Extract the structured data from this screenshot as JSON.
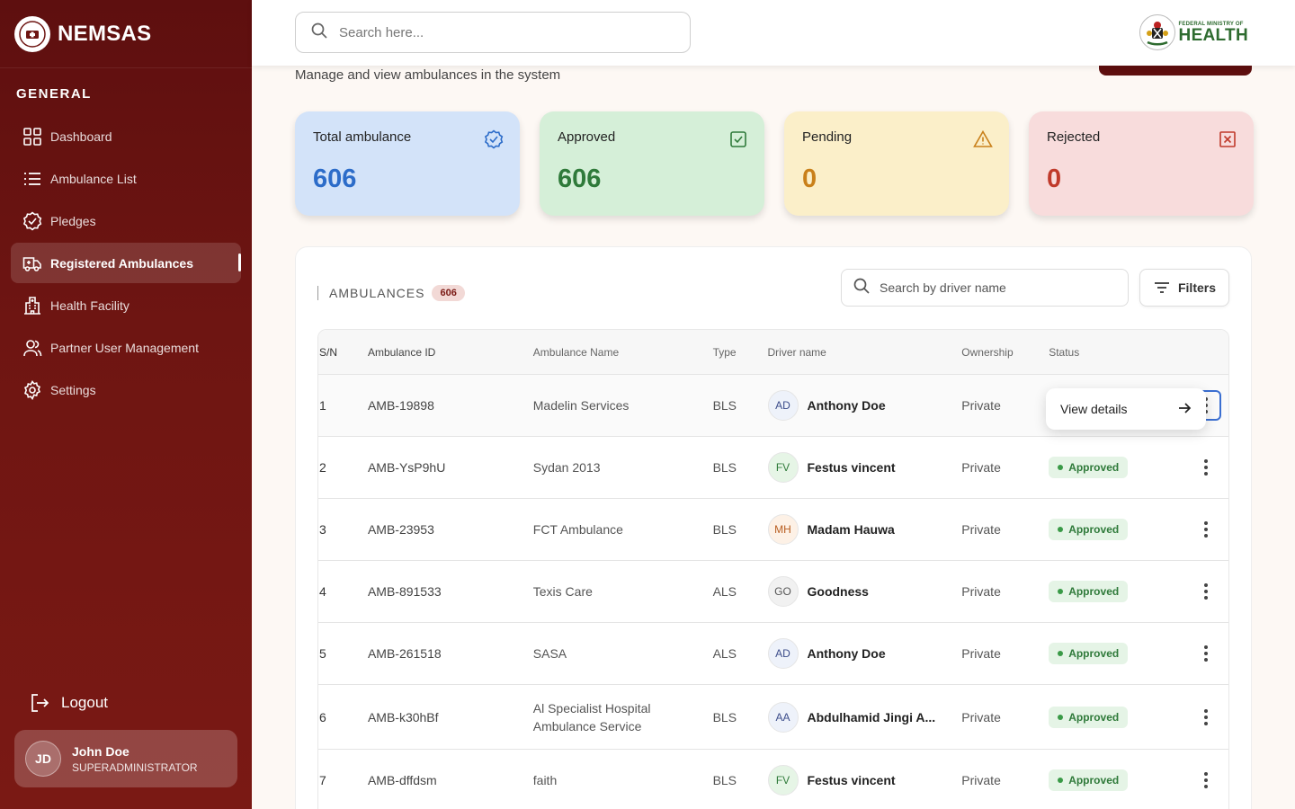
{
  "brand": {
    "name": "NEMSAS"
  },
  "sidebar": {
    "section_title": "GENERAL",
    "items": [
      {
        "label": "Dashboard",
        "icon": "grid-icon"
      },
      {
        "label": "Ambulance List",
        "icon": "list-icon"
      },
      {
        "label": "Pledges",
        "icon": "badge-check-icon"
      },
      {
        "label": "Registered Ambulances",
        "icon": "ambulance-icon",
        "active": true
      },
      {
        "label": "Health Facility",
        "icon": "hospital-icon"
      },
      {
        "label": "Partner User Management",
        "icon": "users-icon"
      },
      {
        "label": "Settings",
        "icon": "gear-icon"
      }
    ],
    "logout_label": "Logout",
    "user": {
      "initials": "JD",
      "name": "John Doe",
      "role": "SUPERADMINISTRATOR"
    }
  },
  "topbar": {
    "search_placeholder": "Search here...",
    "ministry_small": "FEDERAL MINISTRY OF",
    "ministry_big": "HEALTH"
  },
  "page": {
    "subtitle": "Manage and view ambulances in the system"
  },
  "stats": {
    "total": {
      "label": "Total ambulance",
      "value": "606"
    },
    "approved": {
      "label": "Approved",
      "value": "606"
    },
    "pending": {
      "label": "Pending",
      "value": "0"
    },
    "rejected": {
      "label": "Rejected",
      "value": "0"
    }
  },
  "table": {
    "title": "AMBULANCES",
    "count": "606",
    "search_placeholder": "Search by driver name",
    "filters_label": "Filters",
    "headers": {
      "sn": "S/N",
      "id": "Ambulance ID",
      "name": "Ambulance Name",
      "type": "Type",
      "driver": "Driver name",
      "ownership": "Ownership",
      "status": "Status"
    },
    "rows": [
      {
        "sn": "1",
        "id": "AMB-19898",
        "name": "Madelin Services",
        "type": "BLS",
        "initials": "AD",
        "driver": "Anthony Doe",
        "ownership": "Private",
        "status": ""
      },
      {
        "sn": "2",
        "id": "AMB-YsP9hU",
        "name": "Sydan 2013",
        "type": "BLS",
        "initials": "FV",
        "driver": "Festus vincent",
        "ownership": "Private",
        "status": "Approved"
      },
      {
        "sn": "3",
        "id": "AMB-23953",
        "name": "FCT Ambulance",
        "type": "BLS",
        "initials": "MH",
        "driver": "Madam Hauwa",
        "ownership": "Private",
        "status": "Approved"
      },
      {
        "sn": "4",
        "id": "AMB-891533",
        "name": "Texis Care",
        "type": "ALS",
        "initials": "GO",
        "driver": "Goodness",
        "ownership": "Private",
        "status": "Approved"
      },
      {
        "sn": "5",
        "id": "AMB-261518",
        "name": "SASA",
        "type": "ALS",
        "initials": "AD",
        "driver": "Anthony Doe",
        "ownership": "Private",
        "status": "Approved"
      },
      {
        "sn": "6",
        "id": "AMB-k30hBf",
        "name": "Al Specialist Hospital Ambulance Service",
        "type": "BLS",
        "initials": "AA",
        "driver": "Abdulhamid Jingi A...",
        "ownership": "Private",
        "status": "Approved"
      },
      {
        "sn": "7",
        "id": "AMB-dffdsm",
        "name": "faith",
        "type": "BLS",
        "initials": "FV",
        "driver": "Festus vincent",
        "ownership": "Private",
        "status": "Approved"
      }
    ],
    "popover_label": "View details"
  }
}
